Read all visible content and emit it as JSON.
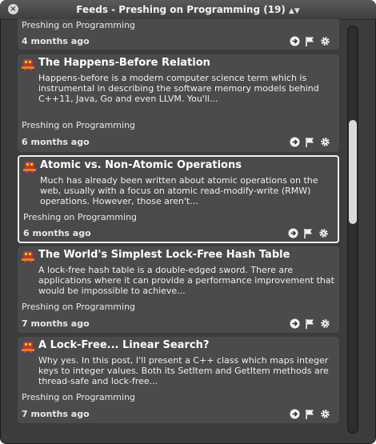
{
  "window": {
    "title": "Feeds - Preshing on Programming (19)",
    "close_glyph": "×",
    "sort_glyph": "▲▼"
  },
  "colors": {
    "card_bg": "#4b4b4b",
    "window_bg": "#3c3c3c",
    "selected_border": "#f4f4f4"
  },
  "top_partial": {
    "feed": "Preshing on Programming",
    "date": "4 months ago"
  },
  "articles": [
    {
      "title": "The Happens-Before Relation",
      "excerpt": "Happens-before is a modern computer science term which is instrumental in describing the software memory models behind C++11, Java, Go and even LLVM. You'll...",
      "feed": "Preshing on Programming",
      "date": "6 months ago"
    },
    {
      "title": "Atomic vs. Non-Atomic Operations",
      "excerpt": "Much has already been written about atomic operations on the web, usually with a focus on atomic read-modify-write (RMW) operations. However, those aren't...",
      "feed": "Preshing on Programming",
      "date": "6 months ago"
    },
    {
      "title": "The World's Simplest Lock-Free Hash Table",
      "excerpt": "A lock-free hash table is a double-edged sword. There are applications where it can provide a performance improvement that would be impossible to achieve...",
      "feed": "Preshing on Programming",
      "date": "7 months ago"
    },
    {
      "title": "A Lock-Free... Linear Search?",
      "excerpt": "Why yes. In this post, I'll present a C++ class which maps integer keys to integer values. Both its SetItem and GetItem methods are thread-safe and lock-free...",
      "feed": "Preshing on Programming",
      "date": "7 months ago"
    }
  ],
  "icons": [
    "open-arrow-icon",
    "flag-icon",
    "gear-icon",
    "feed-icon"
  ]
}
